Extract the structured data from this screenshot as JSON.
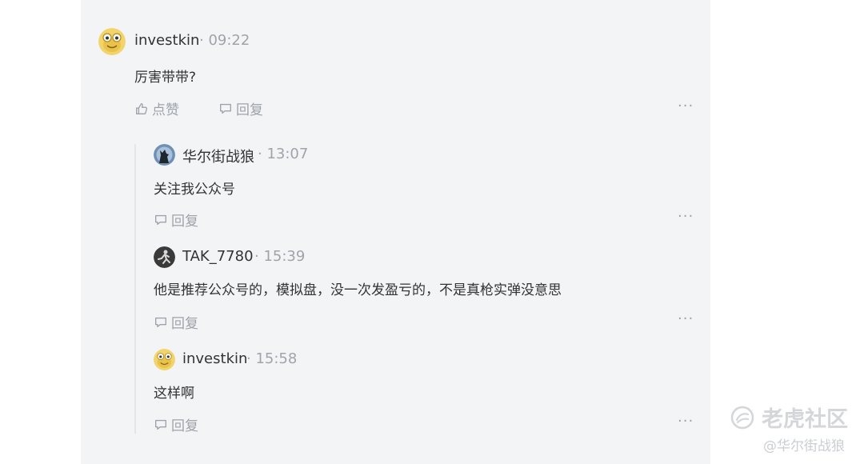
{
  "comment": {
    "user": "investkin",
    "time": "· 09:22",
    "text": "厉害带带?",
    "like_label": "点赞",
    "reply_label": "回复",
    "more_label": "···"
  },
  "replies": [
    {
      "user": "华尔街战狼",
      "time": "· 13:07",
      "text": "关注我公众号",
      "reply_label": "回复",
      "more_label": "···"
    },
    {
      "user": "TAK_7780",
      "time": "· 15:39",
      "text": "他是推荐公众号的，模拟盘，没一次发盈亏的，不是真枪实弹没意思",
      "reply_label": "回复",
      "more_label": "···"
    },
    {
      "user": "investkin",
      "time": "· 15:58",
      "text": "这样啊",
      "reply_label": "回复",
      "more_label": "···"
    }
  ],
  "watermark": {
    "brand": "老虎社区",
    "user": "@华尔街战狼",
    "icon": "tiger-logo-icon"
  },
  "colors": {
    "panel_bg": "#f3f4f6",
    "muted": "#9ea3a9",
    "text": "#333333"
  }
}
